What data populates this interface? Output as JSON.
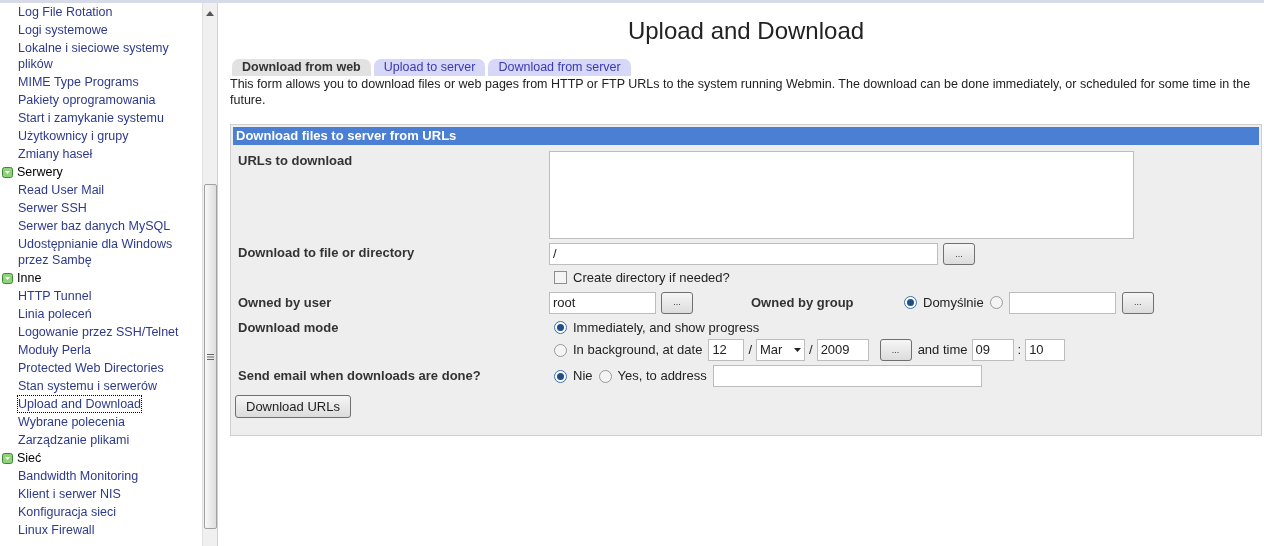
{
  "sidebar": {
    "items": [
      {
        "kind": "link",
        "label": "Log File Rotation",
        "selected": false
      },
      {
        "kind": "link",
        "label": "Logi systemowe",
        "selected": false
      },
      {
        "kind": "link",
        "label": "Lokalne i sieciowe systemy plików",
        "selected": false
      },
      {
        "kind": "link",
        "label": "MIME Type Programs",
        "selected": false
      },
      {
        "kind": "link",
        "label": "Pakiety oprogramowania",
        "selected": false
      },
      {
        "kind": "link",
        "label": "Start i zamykanie systemu",
        "selected": false
      },
      {
        "kind": "link",
        "label": "Użytkownicy i grupy",
        "selected": false
      },
      {
        "kind": "link",
        "label": "Zmiany haseł",
        "selected": false
      },
      {
        "kind": "category",
        "label": "Serwery",
        "selected": false
      },
      {
        "kind": "link",
        "label": "Read User Mail",
        "selected": false
      },
      {
        "kind": "link",
        "label": "Serwer SSH",
        "selected": false
      },
      {
        "kind": "link",
        "label": "Serwer baz danych MySQL",
        "selected": false
      },
      {
        "kind": "link",
        "label": "Udostępnianie dla Windows przez Sambę",
        "selected": false
      },
      {
        "kind": "category",
        "label": "Inne",
        "selected": false
      },
      {
        "kind": "link",
        "label": "HTTP Tunnel",
        "selected": false
      },
      {
        "kind": "link",
        "label": "Linia poleceń",
        "selected": false
      },
      {
        "kind": "link",
        "label": "Logowanie przez SSH/Telnet",
        "selected": false
      },
      {
        "kind": "link",
        "label": "Moduły Perla",
        "selected": false
      },
      {
        "kind": "link",
        "label": "Protected Web Directories",
        "selected": false
      },
      {
        "kind": "link",
        "label": "Stan systemu i serwerów",
        "selected": false
      },
      {
        "kind": "link",
        "label": "Upload and Download",
        "selected": true
      },
      {
        "kind": "link",
        "label": "Wybrane polecenia",
        "selected": false
      },
      {
        "kind": "link",
        "label": "Zarządzanie plikami",
        "selected": false
      },
      {
        "kind": "category",
        "label": "Sieć",
        "selected": false
      },
      {
        "kind": "link",
        "label": "Bandwidth Monitoring",
        "selected": false
      },
      {
        "kind": "link",
        "label": "Klient i serwer NIS",
        "selected": false
      },
      {
        "kind": "link",
        "label": "Konfiguracja sieci",
        "selected": false
      },
      {
        "kind": "link",
        "label": "Linux Firewall",
        "selected": false
      }
    ]
  },
  "page": {
    "title": "Upload and Download",
    "tabs": [
      {
        "label": "Download from web",
        "selected": true
      },
      {
        "label": "Upload to server",
        "selected": false
      },
      {
        "label": "Download from server",
        "selected": false
      }
    ],
    "description": "This form allows you to download files or web pages from HTTP or FTP URLs to the system running Webmin. The download can be done immediately, or scheduled for some time in the future.",
    "form": {
      "title": "Download files to server from URLs",
      "urls": {
        "label": "URLs to download"
      },
      "target": {
        "label": "Download to file or directory",
        "value": "/",
        "browse": "...",
        "create_dir": {
          "label": "Create directory if needed?",
          "checked": false
        }
      },
      "owner": {
        "label": "Owned by user",
        "value": "root",
        "browse": "..."
      },
      "group": {
        "label": "Owned by group",
        "default_label": "Domyślnie",
        "default_selected": true,
        "browse": "..."
      },
      "mode": {
        "label": "Download mode",
        "options": [
          {
            "label": "Immediately, and show progress",
            "selected": true
          },
          {
            "label": "In background, at date",
            "selected": false
          }
        ],
        "day": "12",
        "date_sep_1": "/",
        "month": "Mar",
        "date_sep_2": "/",
        "year": "2009",
        "browse": "...",
        "time_label": "and time",
        "hour": "09",
        "time_sep": ":",
        "minute": "10"
      },
      "email": {
        "label": "Send email when downloads are done?",
        "options": [
          {
            "label": "Nie",
            "selected": true
          },
          {
            "label": "Yes, to address",
            "selected": false
          }
        ]
      },
      "submit": "Download URLs"
    }
  }
}
